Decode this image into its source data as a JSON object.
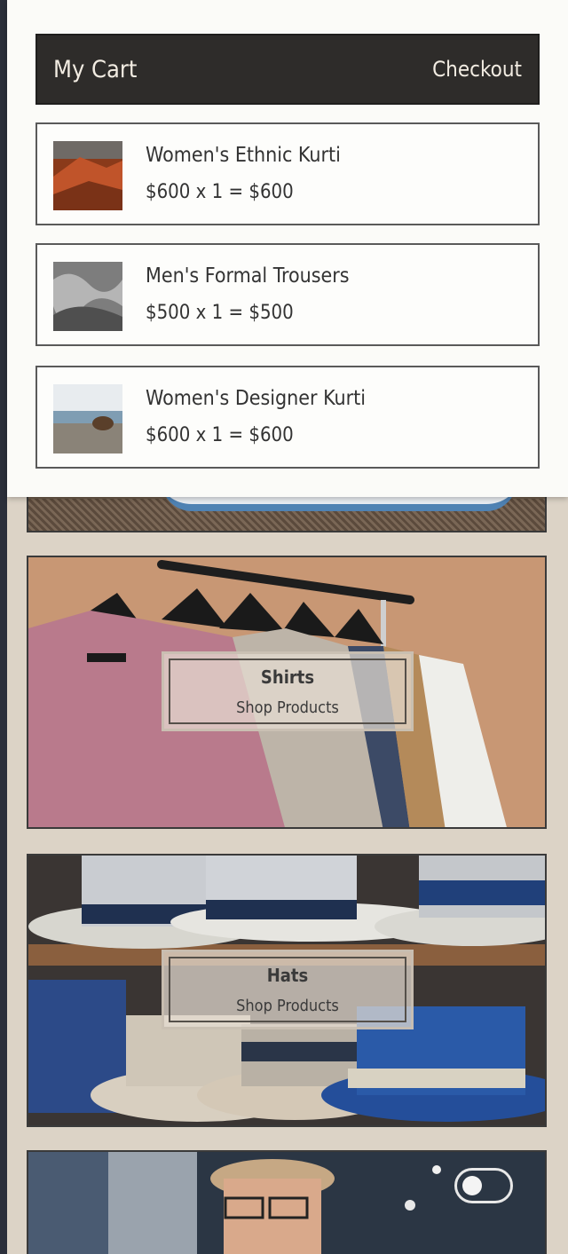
{
  "cart": {
    "title": "My Cart",
    "checkout_label": "Checkout",
    "items": [
      {
        "name": "Women's Ethnic Kurti",
        "price_line": "$600 x 1 = $600",
        "thumb": "red-canyon-photo"
      },
      {
        "name": "Men's Formal Trousers",
        "price_line": "$500 x 1 = $500",
        "thumb": "gray-clouds-photo"
      },
      {
        "name": "Women's Designer Kurti",
        "price_line": "$600 x 1 = $600",
        "thumb": "bear-on-beach-photo"
      }
    ]
  },
  "categories": [
    {
      "name": "Shirts",
      "cta": "Shop Products"
    },
    {
      "name": "Hats",
      "cta": "Shop Products"
    }
  ],
  "colors": {
    "header_bg": "#2e2c2a",
    "page_bg": "#dcd3c6",
    "accent_text": "#f2ece2"
  }
}
